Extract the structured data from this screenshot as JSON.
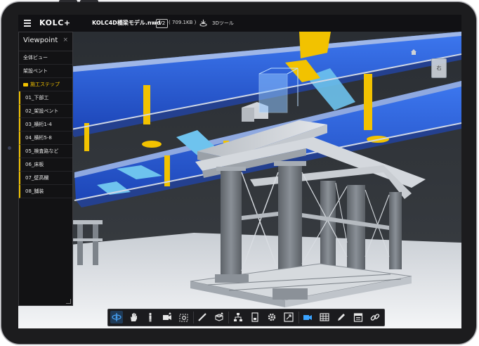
{
  "app": {
    "brand": "KOLC+",
    "filename": "KOLC4D橋梁モデル.nwd",
    "version_badge": "V2",
    "file_size": "( 709.1KB )",
    "tool_label": "3Dツール"
  },
  "viewpoint_panel": {
    "title": "Viewpoint",
    "close_symbol": "×",
    "items": [
      {
        "label": "全体ビュー",
        "kind": "item"
      },
      {
        "label": "架設ベント",
        "kind": "item"
      },
      {
        "label": "施工ステップ",
        "kind": "folder"
      },
      {
        "label": "01_下部工",
        "kind": "sub"
      },
      {
        "label": "02_架設ベント",
        "kind": "sub"
      },
      {
        "label": "03_横桁1-4",
        "kind": "sub"
      },
      {
        "label": "04_横桁5-8",
        "kind": "sub"
      },
      {
        "label": "05_検査路など",
        "kind": "sub"
      },
      {
        "label": "06_床板",
        "kind": "sub"
      },
      {
        "label": "07_壁高欄",
        "kind": "sub"
      },
      {
        "label": "08_舗装",
        "kind": "sub"
      }
    ]
  },
  "viewcube": {
    "face_label": "右"
  },
  "toolbar": {
    "buttons": [
      "orbit-icon",
      "pan-icon",
      "walk-icon",
      "camera-icon",
      "zoom-fit-icon",
      "measure-icon",
      "section-icon",
      "tree-icon",
      "properties-icon",
      "settings-icon",
      "fullscreen-icon",
      "video-icon",
      "grid-icon",
      "markup-pen-icon",
      "calendar-icon",
      "link-icon"
    ]
  },
  "colors": {
    "accent_yellow": "#f2c200",
    "accent_blue": "#3aa3ff",
    "girder_blue": "#2a5bd8",
    "panel_bg": "#121214"
  }
}
